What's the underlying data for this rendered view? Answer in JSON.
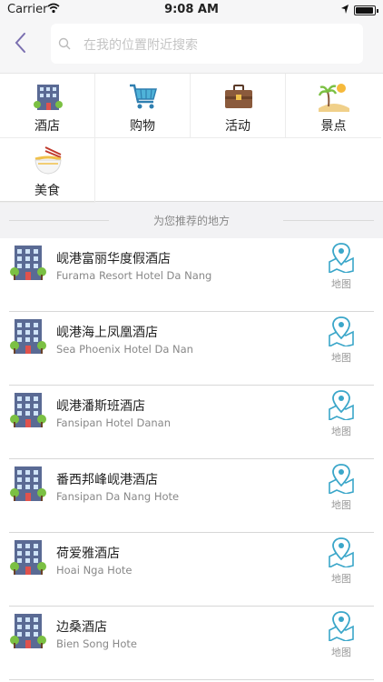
{
  "status_bar": {
    "carrier": "Carrier",
    "time": "9:08 AM",
    "battery_level": 0.95
  },
  "search": {
    "placeholder": "在我的位置附近搜索"
  },
  "categories": [
    {
      "label": "酒店",
      "icon": "hotel-building-icon"
    },
    {
      "label": "购物",
      "icon": "shopping-cart-icon"
    },
    {
      "label": "活动",
      "icon": "briefcase-icon"
    },
    {
      "label": "景点",
      "icon": "beach-palm-icon"
    },
    {
      "label": "美食",
      "icon": "noodle-bowl-icon"
    }
  ],
  "section_title": "为您推荐的地方",
  "places": [
    {
      "name": "岘港富丽华度假酒店",
      "subtitle": "Furama Resort Hotel Da Nang",
      "map_label": "地图"
    },
    {
      "name": "岘港海上凤凰酒店",
      "subtitle": "Sea Phoenix Hotel Da Nan",
      "map_label": "地图"
    },
    {
      "name": "岘港潘斯班酒店",
      "subtitle": "Fansipan Hotel Danan",
      "map_label": "地图"
    },
    {
      "name": "番西邦峰岘港酒店",
      "subtitle": "Fansipan Da Nang Hote",
      "map_label": "地图"
    },
    {
      "name": "荷爱雅酒店",
      "subtitle": "Hoai Nga Hote",
      "map_label": "地图"
    },
    {
      "name": "边桑酒店",
      "subtitle": "Bien Song Hote",
      "map_label": "地图"
    }
  ],
  "colors": {
    "accent": "#7a6fb0",
    "map_icon": "#3aa6c9",
    "building": "#5a6a94",
    "tree": "#7bc043",
    "door": "#e0524d"
  }
}
